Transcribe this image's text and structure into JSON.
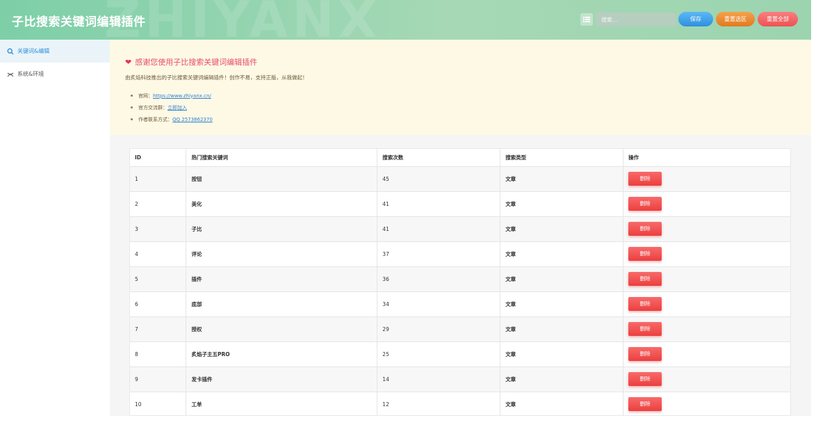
{
  "header": {
    "title": "子比搜索关键词编辑插件",
    "watermark": "ZHIYANX",
    "search_placeholder": "搜索...",
    "save_label": "保存",
    "reset_section_label": "重置选区",
    "reset_all_label": "重置全部"
  },
  "sidebar": {
    "items": [
      {
        "label": "关键词&编辑",
        "icon": "search-icon",
        "active": true
      },
      {
        "label": "系统&环境",
        "icon": "settings-icon",
        "active": false
      }
    ]
  },
  "notice": {
    "title": "感谢您使用子比搜索关键词编辑插件",
    "desc": "由炙焰科技推出的子比搜索关键词编辑插件！创作不易，支持正版，从我做起！",
    "links": [
      {
        "prefix": "官网：",
        "text": "https://www.zhiyanx.cn/"
      },
      {
        "prefix": "官方交流群：",
        "text": "立即加入"
      },
      {
        "prefix": "作者联系方式：",
        "text": "QQ 2573862370"
      }
    ]
  },
  "table": {
    "headers": [
      "ID",
      "热门搜索关键词",
      "搜索次数",
      "搜索类型",
      "操作"
    ],
    "delete_label": "删除",
    "rows": [
      {
        "id": "1",
        "keyword": "按钮",
        "count": "45",
        "type": "文章"
      },
      {
        "id": "2",
        "keyword": "美化",
        "count": "41",
        "type": "文章"
      },
      {
        "id": "3",
        "keyword": "子比",
        "count": "41",
        "type": "文章"
      },
      {
        "id": "4",
        "keyword": "评论",
        "count": "37",
        "type": "文章"
      },
      {
        "id": "5",
        "keyword": "插件",
        "count": "36",
        "type": "文章"
      },
      {
        "id": "6",
        "keyword": "底部",
        "count": "34",
        "type": "文章"
      },
      {
        "id": "7",
        "keyword": "授权",
        "count": "29",
        "type": "文章"
      },
      {
        "id": "8",
        "keyword": "炙焰子主五PRO",
        "count": "25",
        "type": "文章"
      },
      {
        "id": "9",
        "keyword": "发卡插件",
        "count": "14",
        "type": "文章"
      },
      {
        "id": "10",
        "keyword": "工单",
        "count": "12",
        "type": "文章"
      }
    ]
  },
  "colors": {
    "header_gradient_start": "#7dcfa8",
    "accent_blue": "#2f8fe0",
    "danger_red": "#ec3f3f",
    "orange": "#e27a1f",
    "notice_bg": "#fdf9e5",
    "notice_title": "#e84d6a"
  }
}
